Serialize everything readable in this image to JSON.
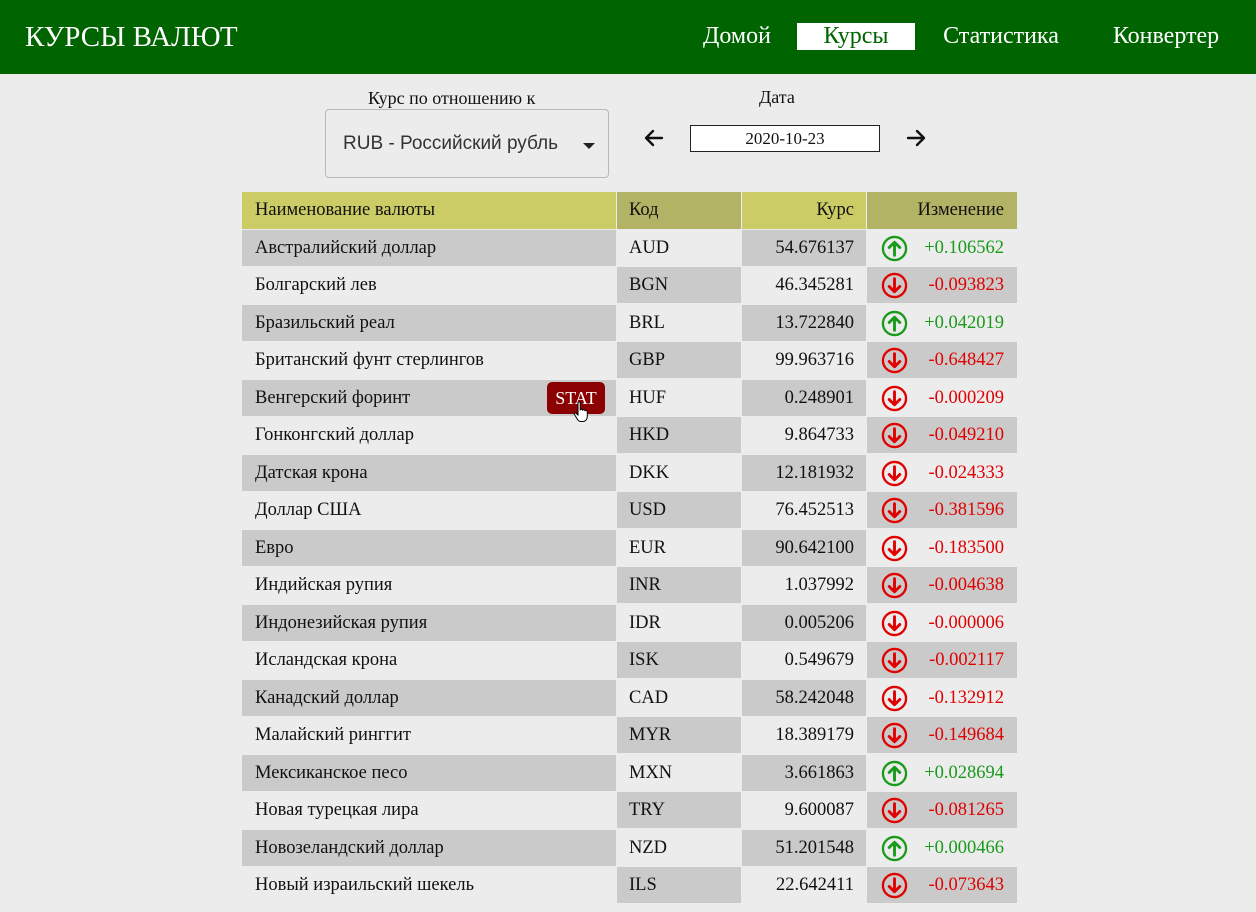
{
  "header": {
    "brand": "КУРСЫ ВАЛЮТ",
    "nav": [
      "Домой",
      "Курсы",
      "Статистика",
      "Конвертер"
    ],
    "active_nav": "Курсы"
  },
  "controls": {
    "base_label": "Курс по отношению к",
    "base_value": "RUB - Российский рубль",
    "date_label": "Дата",
    "date_value": "2020-10-23"
  },
  "table": {
    "headers": [
      "Наименование валюты",
      "Код",
      "Курс",
      "Изменение"
    ],
    "stat_label": "STAT",
    "rows": [
      {
        "name": "Австралийский доллар",
        "code": "AUD",
        "rate": "54.676137",
        "change": "+0.106562",
        "dir": "up"
      },
      {
        "name": "Болгарский лев",
        "code": "BGN",
        "rate": "46.345281",
        "change": "-0.093823",
        "dir": "down"
      },
      {
        "name": "Бразильский реал",
        "code": "BRL",
        "rate": "13.722840",
        "change": "+0.042019",
        "dir": "up"
      },
      {
        "name": "Британский фунт стерлингов",
        "code": "GBP",
        "rate": "99.963716",
        "change": "-0.648427",
        "dir": "down"
      },
      {
        "name": "Венгерский форинт",
        "code": "HUF",
        "rate": "0.248901",
        "change": "-0.000209",
        "dir": "down"
      },
      {
        "name": "Гонконгский доллар",
        "code": "HKD",
        "rate": "9.864733",
        "change": "-0.049210",
        "dir": "down"
      },
      {
        "name": "Датская крона",
        "code": "DKK",
        "rate": "12.181932",
        "change": "-0.024333",
        "dir": "down"
      },
      {
        "name": "Доллар США",
        "code": "USD",
        "rate": "76.452513",
        "change": "-0.381596",
        "dir": "down"
      },
      {
        "name": "Евро",
        "code": "EUR",
        "rate": "90.642100",
        "change": "-0.183500",
        "dir": "down"
      },
      {
        "name": "Индийская рупия",
        "code": "INR",
        "rate": "1.037992",
        "change": "-0.004638",
        "dir": "down"
      },
      {
        "name": "Индонезийская рупия",
        "code": "IDR",
        "rate": "0.005206",
        "change": "-0.000006",
        "dir": "down"
      },
      {
        "name": "Исландская крона",
        "code": "ISK",
        "rate": "0.549679",
        "change": "-0.002117",
        "dir": "down"
      },
      {
        "name": "Канадский доллар",
        "code": "CAD",
        "rate": "58.242048",
        "change": "-0.132912",
        "dir": "down"
      },
      {
        "name": "Малайский ринггит",
        "code": "MYR",
        "rate": "18.389179",
        "change": "-0.149684",
        "dir": "down"
      },
      {
        "name": "Мексиканское песо",
        "code": "MXN",
        "rate": "3.661863",
        "change": "+0.028694",
        "dir": "up"
      },
      {
        "name": "Новая турецкая лира",
        "code": "TRY",
        "rate": "9.600087",
        "change": "-0.081265",
        "dir": "down"
      },
      {
        "name": "Новозеландский доллар",
        "code": "NZD",
        "rate": "51.201548",
        "change": "+0.000466",
        "dir": "up"
      },
      {
        "name": "Новый израильский шекель",
        "code": "ILS",
        "rate": "22.642411",
        "change": "-0.073643",
        "dir": "down"
      }
    ]
  },
  "colors": {
    "header_bg": "#006400",
    "up": "#1a9a1a",
    "down": "#e00000",
    "stat_bg": "#8b0000",
    "table_header_light": "#cccc66",
    "table_header_dark": "#b3b366"
  }
}
